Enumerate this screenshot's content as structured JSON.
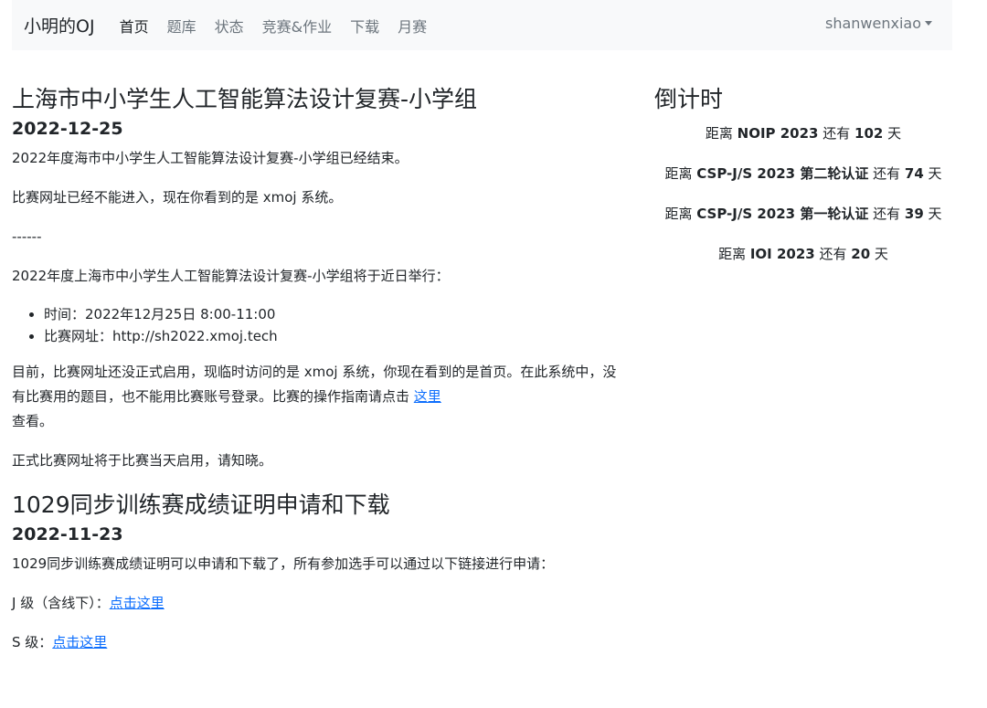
{
  "navbar": {
    "brand": "小明的OJ",
    "links": [
      "首页",
      "题库",
      "状态",
      "竞赛&作业",
      "下载",
      "月赛"
    ],
    "user": "shanwenxiao"
  },
  "posts": [
    {
      "title": "上海市中小学生人工智能算法设计复赛-小学组",
      "date": "2022-12-25",
      "p1": "2022年度海市中小学生人工智能算法设计复赛-小学组已经结束。",
      "p2": "比赛网址已经不能进入，现在你看到的是 xmoj 系统。",
      "separator": "------",
      "p3": "2022年度上海市中小学生人工智能算法设计复赛-小学组将于近日举行：",
      "list": [
        "时间：2022年12月25日 8:00-11:00",
        "比赛网址：http://sh2022.xmoj.tech"
      ],
      "p4_text": "目前，比赛网址还没正式启用，现临时访问的是 xmoj 系统，你现在看到的是首页。在此系统中，没有比赛用的题目，也不能用比赛账号登录。比赛的操作指南请点击 ",
      "p4_link": "这里",
      "p4_after": "查看。",
      "p5": "正式比赛网址将于比赛当天启用，请知晓。"
    },
    {
      "title": "1029同步训练赛成绩证明申请和下载",
      "date": "2022-11-23",
      "p1": "1029同步训练赛成绩证明可以申请和下载了，所有参加选手可以通过以下链接进行申请：",
      "j_label": "J 级（含线下）：",
      "j_link": "点击这里",
      "s_label": "S 级：",
      "s_link": "点击这里"
    }
  ],
  "sidebar": {
    "title": "倒计时",
    "items": [
      {
        "prefix": "距离 ",
        "event": "NOIP 2023",
        "middle": " 还有 ",
        "days": "102",
        "suffix": " 天"
      },
      {
        "prefix": "距离 ",
        "event": "CSP-J/S 2023 第二轮认证",
        "middle": " 还有 ",
        "days": "74",
        "suffix": " 天"
      },
      {
        "prefix": "距离 ",
        "event": "CSP-J/S 2023 第一轮认证",
        "middle": " 还有 ",
        "days": "39",
        "suffix": " 天"
      },
      {
        "prefix": "距离 ",
        "event": "IOI 2023",
        "middle": " 还有 ",
        "days": "20",
        "suffix": " 天"
      }
    ]
  }
}
